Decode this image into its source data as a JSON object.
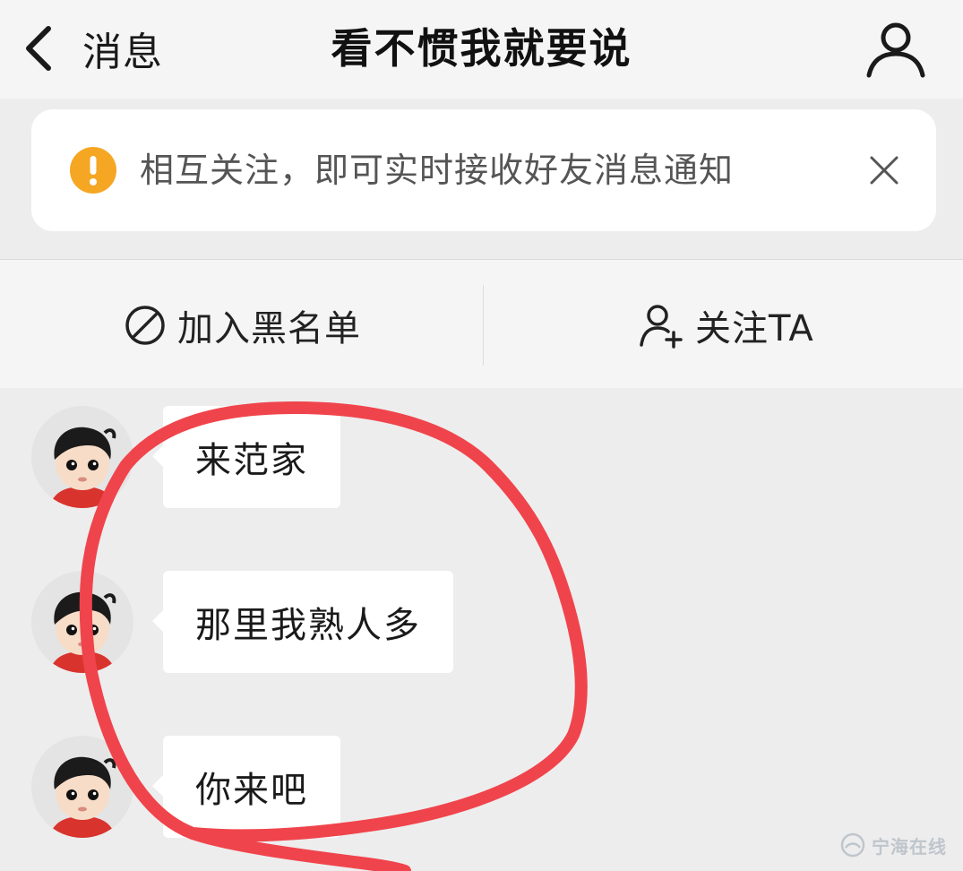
{
  "header": {
    "back_label": "消息",
    "title": "看不惯我就要说",
    "back_icon": "chevron-left-icon",
    "profile_icon": "user-icon"
  },
  "notice": {
    "text": "相互关注，即可实时接收好友消息通知",
    "icon": "exclamation-icon",
    "close_icon": "close-icon",
    "icon_color": "#F5A623"
  },
  "actions": {
    "blacklist": {
      "label": "加入黑名单",
      "icon": "block-icon"
    },
    "follow": {
      "label": "关注TA",
      "icon": "add-user-icon"
    }
  },
  "messages": [
    {
      "text": "来范家"
    },
    {
      "text": "那里我熟人多"
    },
    {
      "text": "你来吧"
    }
  ],
  "annotation": {
    "color": "#F0444C",
    "shape": "hand-drawn circle around messages"
  },
  "watermark": {
    "text": "宁海在线"
  }
}
